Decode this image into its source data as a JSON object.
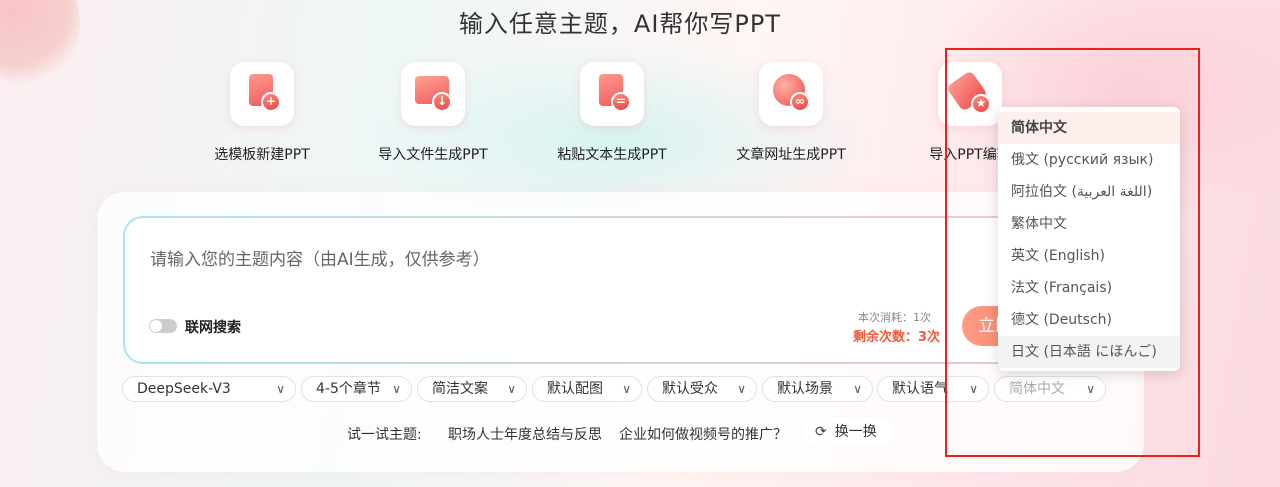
{
  "title": "输入任意主题，AI帮你写PPT",
  "features": [
    {
      "label": "选模板新建PPT",
      "icon": "template-plus-icon"
    },
    {
      "label": "导入文件生成PPT",
      "icon": "folder-import-icon"
    },
    {
      "label": "粘贴文本生成PPT",
      "icon": "clipboard-text-icon"
    },
    {
      "label": "文章网址生成PPT",
      "icon": "globe-link-icon"
    },
    {
      "label": "导入PPT编辑",
      "icon": "tag-star-icon"
    }
  ],
  "input": {
    "placeholder": "请输入您的主题内容（由AI生成，仅供参考）",
    "web_search_label": "联网搜索",
    "web_search_enabled": false,
    "cost_text": "本次消耗：1次",
    "remaining_text": "剩余次数：3次",
    "generate_button": "立即"
  },
  "options": [
    {
      "label": "DeepSeek-V3"
    },
    {
      "label": "4-5个章节"
    },
    {
      "label": "简洁文案"
    },
    {
      "label": "默认配图"
    },
    {
      "label": "默认受众"
    },
    {
      "label": "默认场景"
    },
    {
      "label": "默认语气"
    },
    {
      "label": "简体中文"
    }
  ],
  "try": {
    "label": "试一试主题:",
    "topics": [
      "职场人士年度总结与反思",
      "企业如何做视频号的推广？"
    ],
    "refresh_label": "换一换"
  },
  "language_dropdown": {
    "selected": "简体中文",
    "items": [
      "简体中文",
      "俄文 (русский язык)",
      "阿拉伯文 (اللغة العربية)",
      "繁体中文",
      "英文 (English)",
      "法文 (Français)",
      "德文 (Deutsch)",
      "日文 (日本語 にほんご)"
    ]
  },
  "colors": {
    "accent": "#fa7a66",
    "remaining": "#f25a3c",
    "highlight_box": "#e8231e"
  }
}
